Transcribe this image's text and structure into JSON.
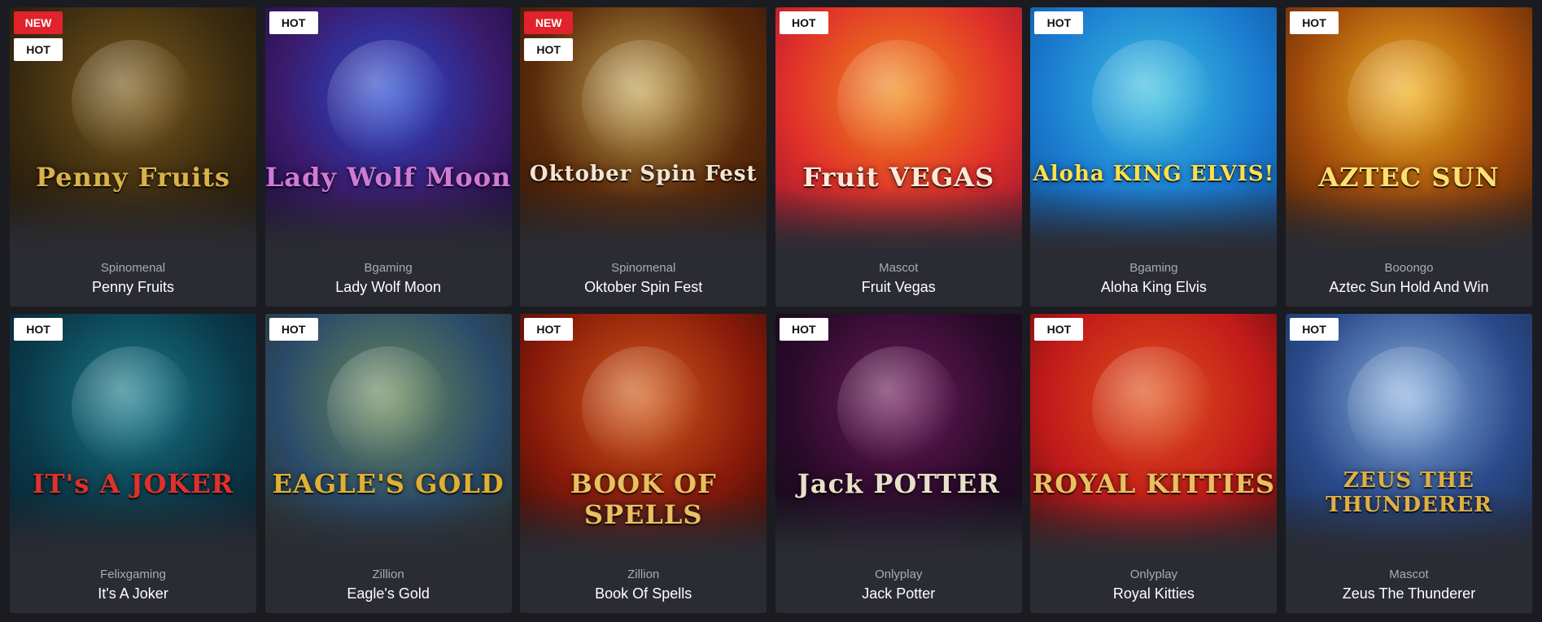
{
  "badges": {
    "hot": "HOT",
    "new": "NEW"
  },
  "games": [
    {
      "provider": "Spinomenal",
      "title": "Penny Fruits",
      "badges": [
        "new",
        "hot"
      ],
      "bg": [
        "#3a2a10",
        "#7a5a1a",
        "#1a1208"
      ],
      "logo": "Penny Fruits",
      "logo_color": "#d8b24a"
    },
    {
      "provider": "Bgaming",
      "title": "Lady Wolf Moon",
      "badges": [
        "hot"
      ],
      "bg": [
        "#3a1a6a",
        "#2a4ad0",
        "#160a30"
      ],
      "logo": "Lady Wolf Moon",
      "logo_color": "#d07ad8"
    },
    {
      "provider": "Spinomenal",
      "title": "Oktober Spin Fest",
      "badges": [
        "new",
        "hot"
      ],
      "bg": [
        "#5a2a0a",
        "#c0a050",
        "#2a1208"
      ],
      "logo": "Oktober Spin Fest",
      "logo_color": "#f2e6d2"
    },
    {
      "provider": "Mascot",
      "title": "Fruit Vegas",
      "badges": [
        "hot"
      ],
      "bg": [
        "#e0302a",
        "#f08a1a",
        "#8a1030"
      ],
      "logo": "Fruit VEGAS",
      "logo_color": "#ffe8d8"
    },
    {
      "provider": "Bgaming",
      "title": "Aloha King Elvis",
      "badges": [
        "hot"
      ],
      "bg": [
        "#1a7ad0",
        "#3ac0e0",
        "#104a8a"
      ],
      "logo": "Aloha KING ELVIS!",
      "logo_color": "#ffe04a"
    },
    {
      "provider": "Booongo",
      "title": "Aztec Sun Hold And Win",
      "badges": [
        "hot"
      ],
      "bg": [
        "#a04a0a",
        "#f0b020",
        "#3a1a08"
      ],
      "logo": "AZTEC SUN",
      "logo_color": "#ffe070"
    },
    {
      "provider": "Felixgaming",
      "title": "It's A Joker",
      "badges": [
        "hot"
      ],
      "bg": [
        "#0a3a4a",
        "#1a7a8a",
        "#0a1a2a"
      ],
      "logo": "IT's A JOKER",
      "logo_color": "#e0302a"
    },
    {
      "provider": "Zillion",
      "title": "Eagle's Gold",
      "badges": [
        "hot"
      ],
      "bg": [
        "#2a4a6a",
        "#6a8a5a",
        "#2a2a18"
      ],
      "logo": "EAGLE'S GOLD",
      "logo_color": "#e0b030"
    },
    {
      "provider": "Zillion",
      "title": "Book Of Spells",
      "badges": [
        "hot"
      ],
      "bg": [
        "#8a1a0a",
        "#d05a1a",
        "#2a0a08"
      ],
      "logo": "BOOK OF SPELLS",
      "logo_color": "#e8c060"
    },
    {
      "provider": "Onlyplay",
      "title": "Jack Potter",
      "badges": [
        "hot"
      ],
      "bg": [
        "#2a0a2a",
        "#6a1a5a",
        "#0a0a14"
      ],
      "logo": "Jack POTTER",
      "logo_color": "#e8e0c8"
    },
    {
      "provider": "Onlyplay",
      "title": "Royal Kitties",
      "badges": [
        "hot"
      ],
      "bg": [
        "#c01a1a",
        "#e0501a",
        "#4a0a0a"
      ],
      "logo": "ROYAL KITTIES",
      "logo_color": "#e8c060"
    },
    {
      "provider": "Mascot",
      "title": "Zeus The Thunderer",
      "badges": [
        "hot"
      ],
      "bg": [
        "#2a4a8a",
        "#8ab0e0",
        "#1a2a4a"
      ],
      "logo": "ZEUS THE THUNDERER",
      "logo_color": "#e0b040"
    }
  ]
}
